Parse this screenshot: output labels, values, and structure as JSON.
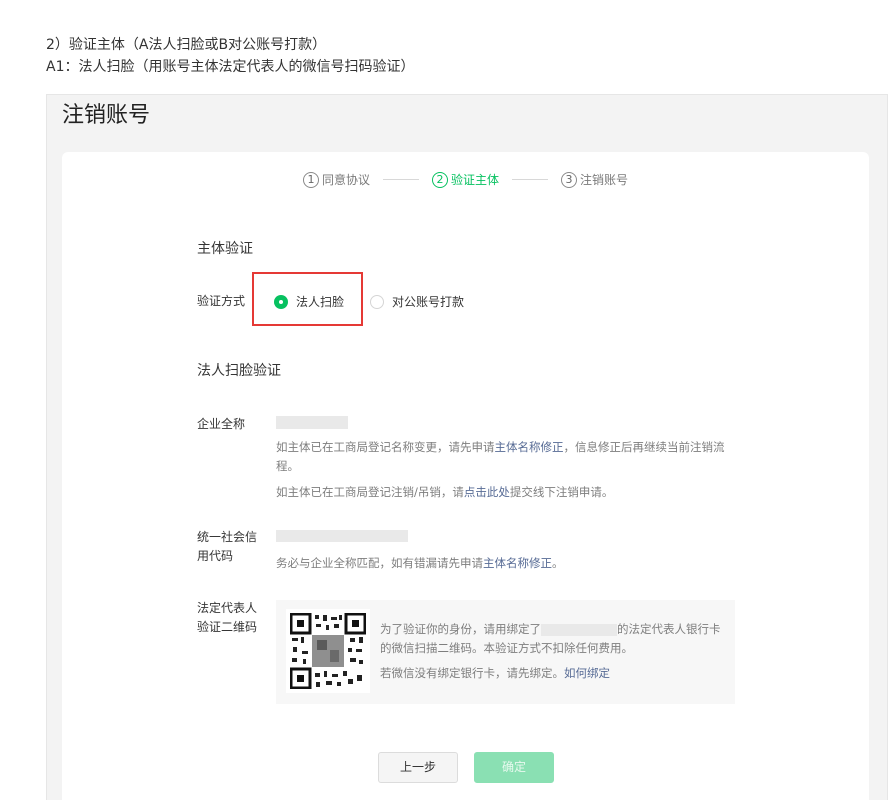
{
  "intro": {
    "line1": "2）验证主体（A法人扫脸或B对公账号打款）",
    "line2": "A1：法人扫脸（用账号主体法定代表人的微信号扫码验证）"
  },
  "panel": {
    "title": "注销账号"
  },
  "steps": [
    {
      "num": "1",
      "label": "同意协议"
    },
    {
      "num": "2",
      "label": "验证主体"
    },
    {
      "num": "3",
      "label": "注销账号"
    }
  ],
  "active_step": 2,
  "form": {
    "section_subject": "主体验证",
    "method_label": "验证方式",
    "method_options": [
      "法人扫脸",
      "对公账号打款"
    ],
    "method_selected": "法人扫脸",
    "section_face": "法人扫脸验证",
    "company_label": "企业全称",
    "company_hint1_a": "如主体已在工商局登记名称变更，请先申请",
    "company_hint1_link": "主体名称修正",
    "company_hint1_b": "，信息修正后再继续当前注销流程。",
    "company_hint2_a": "如主体已在工商局登记注销/吊销，请",
    "company_hint2_link": "点击此处",
    "company_hint2_b": "提交线下注销申请。",
    "credit_label_1": "统一社会信",
    "credit_label_2": "用代码",
    "credit_hint_a": "务必与企业全称匹配，如有错漏请先申请",
    "credit_hint_link": "主体名称修正",
    "credit_hint_b": "。",
    "qr_label_1": "法定代表人",
    "qr_label_2": "验证二维码",
    "qr_text_a": "为了验证你的身份，请用绑定了",
    "qr_text_b": "的法定代表人银行卡的微信扫描二维码。本验证方式不扣除任何费用。",
    "qr_text_2a": "若微信没有绑定银行卡，请先绑定。",
    "qr_text_2_link": "如何绑定"
  },
  "buttons": {
    "prev": "上一步",
    "confirm": "确定"
  },
  "colors": {
    "accent": "#07c160",
    "link": "#576b95",
    "highlight": "#e53935",
    "confirm_disabled": "#8ae0b3"
  }
}
